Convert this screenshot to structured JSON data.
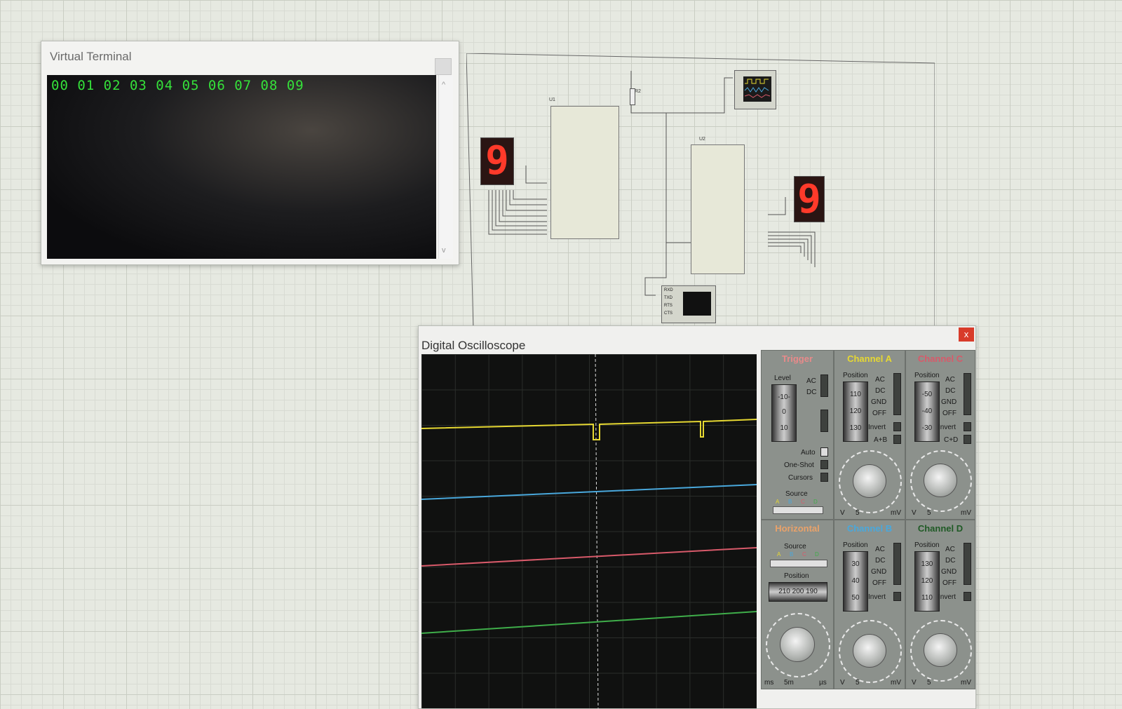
{
  "virtual_terminal": {
    "title": "Virtual Terminal",
    "output": "00 01 02 03 04 05 06 07 08 09",
    "scroll_up": "^",
    "scroll_down": "v"
  },
  "schematic": {
    "u1_label": "U1",
    "u2_label": "U2",
    "r2_label": "R2",
    "seven_seg_left": "9",
    "seven_seg_right": "9",
    "uart_pins": [
      "RXD",
      "TXD",
      "RTS",
      "CTS"
    ]
  },
  "oscilloscope": {
    "title": "Digital Oscilloscope",
    "close_label": "x",
    "trigger": {
      "title": "Trigger",
      "level_label": "Level",
      "ac": "AC",
      "dc": "DC",
      "auto": "Auto",
      "one_shot": "One-Shot",
      "cursors": "Cursors",
      "source_label": "Source",
      "sources": [
        "A",
        "B",
        "C",
        "D"
      ],
      "level_values": [
        "-10-",
        "0",
        "10"
      ]
    },
    "horizontal": {
      "title": "Horizontal",
      "source_label": "Source",
      "sources": [
        "A",
        "B",
        "C",
        "D"
      ],
      "position_label": "Position",
      "position_values": "210 200 190",
      "timebase": "5m",
      "unit_ms": "ms",
      "unit_us": "µs"
    },
    "channel_a": {
      "title": "Channel A",
      "position_label": "Position",
      "values": [
        "110",
        "120",
        "130"
      ],
      "modes": [
        "AC",
        "DC",
        "GND",
        "OFF"
      ],
      "invert": "Invert",
      "extra": "A+B",
      "scale": "5",
      "unit_v": "V",
      "unit_mv": "mV"
    },
    "channel_b": {
      "title": "Channel B",
      "position_label": "Position",
      "values": [
        "30",
        "40",
        "50"
      ],
      "modes": [
        "AC",
        "DC",
        "GND",
        "OFF"
      ],
      "invert": "Invert",
      "scale": "5",
      "unit_v": "V",
      "unit_mv": "mV"
    },
    "channel_c": {
      "title": "Channel C",
      "position_label": "Position",
      "values": [
        "-50",
        "-40",
        "-30"
      ],
      "modes": [
        "AC",
        "DC",
        "GND",
        "OFF"
      ],
      "invert": "Invert",
      "extra": "C+D",
      "scale": "5",
      "unit_v": "V",
      "unit_mv": "mV"
    },
    "channel_d": {
      "title": "Channel D",
      "position_label": "Position",
      "values": [
        "130",
        "120",
        "110"
      ],
      "modes": [
        "AC",
        "DC",
        "GND",
        "OFF"
      ],
      "invert": "Invert",
      "scale": "5",
      "unit_v": "V",
      "unit_mv": "mV"
    },
    "colors": {
      "channel_a": "#e6d832",
      "channel_b": "#49a8dc",
      "channel_c": "#d85a6a",
      "channel_d": "#3fae4a",
      "trigger_title": "#e88a8a",
      "horizontal_title": "#e9a26a"
    }
  }
}
